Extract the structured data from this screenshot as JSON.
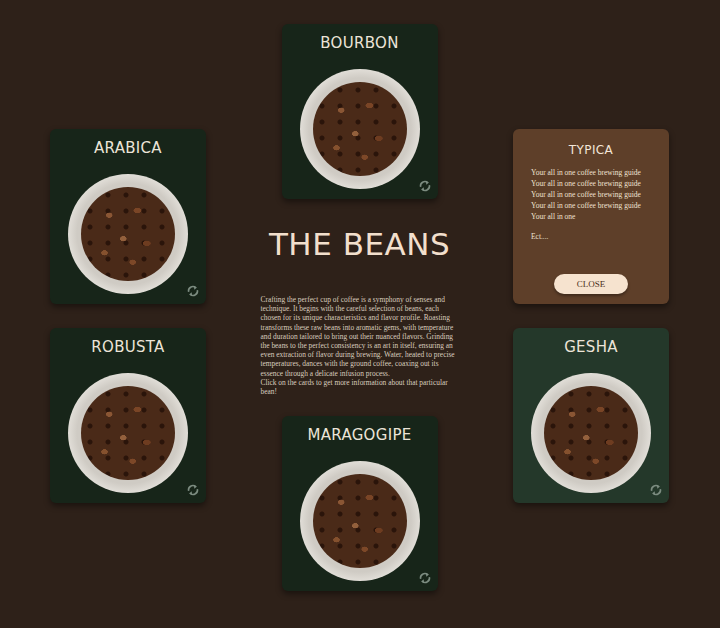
{
  "top_card": {
    "name": "BOURBON",
    "flipped": false,
    "hovered": false
  },
  "left_cards": [
    {
      "name": "ARABICA",
      "flipped": false,
      "hovered": false
    },
    {
      "name": "ROBUSTA",
      "flipped": false,
      "hovered": false
    }
  ],
  "right_cards": [
    {
      "name": "TYPICA",
      "flipped": true,
      "hovered": false,
      "lines": [
        "Your all in one coffee brewing guide",
        "Your all in one coffee brewing guide",
        "Your all in one coffee brewing guide",
        "Your all in one coffee brewing guide",
        "Your all in one"
      ],
      "more": "Ect....",
      "close": "CLOSE"
    },
    {
      "name": "GESHA",
      "flipped": false,
      "hovered": true
    }
  ],
  "bottom_card": {
    "name": "MARAGOGIPE",
    "flipped": false,
    "hovered": false
  },
  "title": "THE BEANS",
  "intro": "Crafting the perfect cup of coffee is a symphony of senses and technique. It begins with the careful selection of beans, each chosen for its unique characteristics and flavor profile. Roasting transforms these raw beans into aromatic gems, with temperature and duration tailored to bring out their nuanced flavors. Grinding the beans to the perfect consistency is an art in itself, ensuring an even extraction of flavor during brewing. Water, heated to precise temperatures, dances with the ground coffee, coaxing out its essence through a delicate infusion process.",
  "hint": "Click on the cards to get more information about that particular bean!"
}
